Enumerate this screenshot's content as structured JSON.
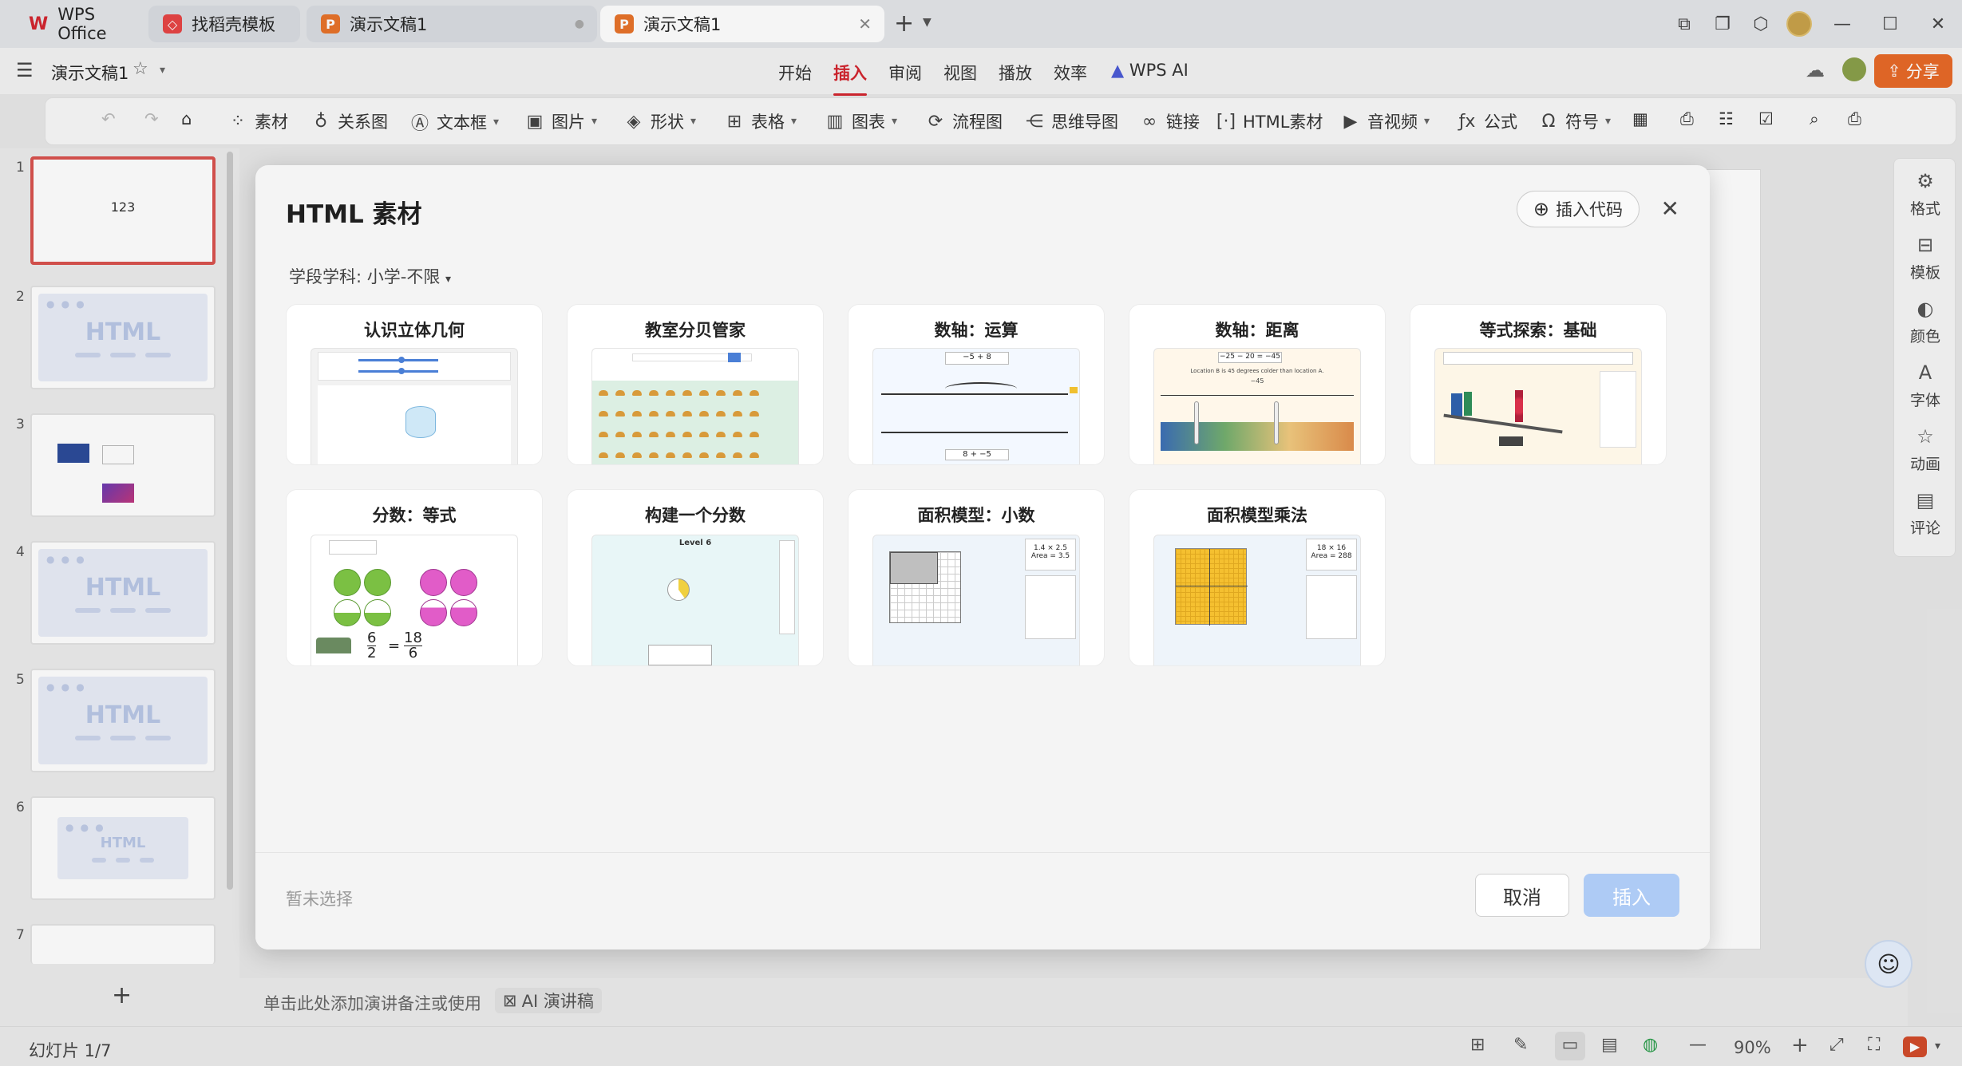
{
  "tabs": {
    "wps_office": "WPS Office",
    "templates": "找稻壳模板",
    "doc_inactive": "演示文稿1",
    "doc_active": "演示文稿1",
    "new_tab": "+"
  },
  "menubar": {
    "doc_name": "演示文稿1",
    "items": [
      "开始",
      "插入",
      "审阅",
      "视图",
      "播放",
      "效率",
      "WPS AI"
    ],
    "active": "插入",
    "share": "分享"
  },
  "toolbar": {
    "items": [
      "素材",
      "关系图",
      "文本框",
      "图片",
      "形状",
      "表格",
      "图表",
      "流程图",
      "思维导图",
      "链接",
      "HTML素材",
      "音视频",
      "公式",
      "符号"
    ]
  },
  "slides": {
    "numbers": [
      "1",
      "2",
      "3",
      "4",
      "5",
      "6",
      "7"
    ],
    "slide1_text": "123",
    "html_label": "HTML",
    "add": "+"
  },
  "right_panel": [
    "格式",
    "模板",
    "颜色",
    "字体",
    "动画",
    "评论"
  ],
  "notes": {
    "placeholder": "单击此处添加演讲备注或使用",
    "ai_btn": "AI 演讲稿"
  },
  "status": {
    "slide_counter": "幻灯片 1/7",
    "zoom": "90%"
  },
  "dialog": {
    "title": "HTML 素材",
    "insert_code": "插入代码",
    "filter": "学段学科: 小学-不限",
    "cards": [
      "认识立体几何",
      "教室分贝管家",
      "数轴：运算",
      "数轴：距离",
      "等式探索：基础",
      "分数：等式",
      "构建一个分数",
      "面积模型：小数",
      "面积模型乘法"
    ],
    "no_selection": "暂未选择",
    "cancel": "取消",
    "insert": "插入"
  },
  "previews": {
    "p3_eq1": "−5 + 8",
    "p3_eq2": "8 + −5",
    "p4_eq": "−25 − 20 = −45",
    "p4_caption": "Location B is 45 degrees colder than location A.",
    "p4_val": "−45",
    "p6_num1": "6",
    "p6_den1": "2",
    "p6_num2": "18",
    "p6_den2": "6",
    "p7_level": "Level 6",
    "p8_expr": "1.4 × 2.5",
    "p8_area": "Area = 3.5",
    "p9_expr": "18 × 16",
    "p9_area": "Area = 288"
  },
  "colors": {
    "accent_red": "#d3262f",
    "share_orange": "#e86a28",
    "insert_disabled": "#aecbf5"
  }
}
